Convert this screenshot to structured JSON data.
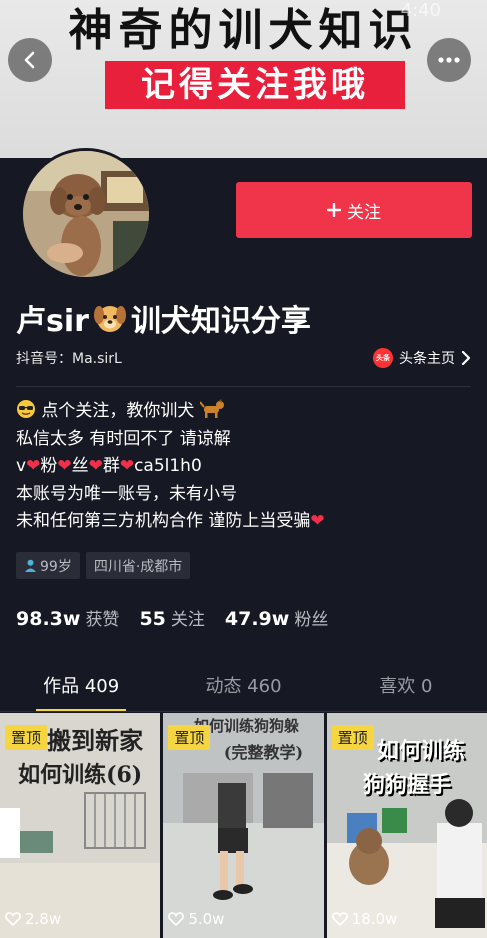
{
  "banner": {
    "title": "神奇的训犬知识",
    "subtitle": "记得关注我哦",
    "status_time_ghost": "4:40"
  },
  "header": {
    "back_label": "返回",
    "more_label": "更多"
  },
  "profile": {
    "follow_label": "关注",
    "name_before": "卢sir",
    "name_after": "训犬知识分享",
    "douyin_id": "抖音号：Ma.sirL",
    "toutiao_logo": "头条",
    "toutiao_label": "头条主页",
    "bio": {
      "line1": "点个关注，教你训犬",
      "line2": "私信太多 有时回不了 请谅解",
      "line3": [
        "v",
        "粉",
        "丝",
        "群",
        "ca5l1h0"
      ],
      "line4": "本账号为唯一账号，未有小号",
      "line5": "未和任何第三方机构合作 谨防上当受骗"
    },
    "tags": {
      "age": "99岁",
      "location": "四川省·成都市"
    },
    "stats": [
      {
        "num": "98.3w",
        "label": "获赞"
      },
      {
        "num": "55",
        "label": "关注"
      },
      {
        "num": "47.9w",
        "label": "粉丝"
      }
    ]
  },
  "tabs": [
    {
      "label": "作品 409"
    },
    {
      "label": "动态 460"
    },
    {
      "label": "喜欢 0"
    }
  ],
  "videos": [
    {
      "pin": "置顶",
      "cover_line1": "搬到新家",
      "cover_line2": "如何训练(6)",
      "likes": "2.8w"
    },
    {
      "pin": "置顶",
      "cover_line1": "如何训练狗狗躲",
      "cover_line2": "(完整教学)",
      "likes": "5.0w"
    },
    {
      "pin": "置顶",
      "cover_line1": "如何训练",
      "cover_line2": "狗狗握手",
      "likes": "18.0w"
    }
  ],
  "colors": {
    "background": "#161823",
    "accent": "#f0344a",
    "pin": "#f5d542"
  }
}
